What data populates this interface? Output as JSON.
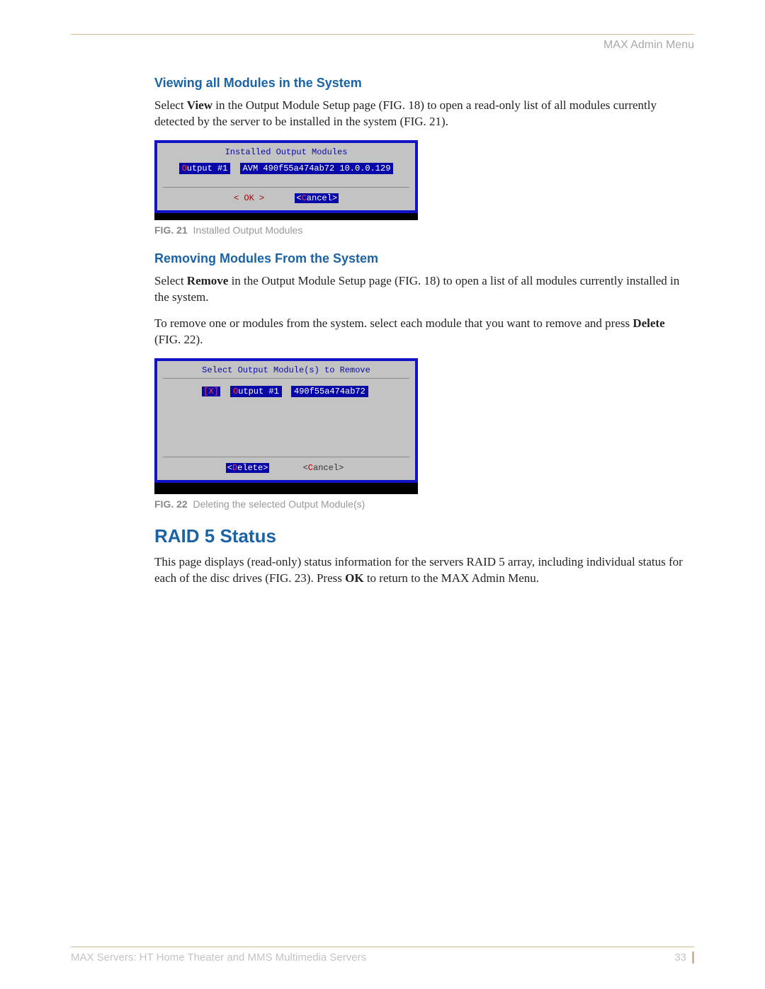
{
  "header": {
    "section": "MAX Admin Menu"
  },
  "sections": {
    "view": {
      "heading": "Viewing all Modules in the System",
      "p1a": "Select ",
      "p1b": "View",
      "p1c": " in the Output Module Setup page (FIG. 18) to open a read-only list of all modules currently detected by the server to be installed in the system (FIG. 21)."
    },
    "remove": {
      "heading": "Removing Modules From the System",
      "p1a": "Select ",
      "p1b": "Remove",
      "p1c": " in the Output Module Setup page (FIG. 18) to open a list of all modules currently installed in the system.",
      "p2a": "To remove one or modules from the system. select each module that you want to remove and press ",
      "p2b": "Delete",
      "p2c": " (FIG. 22)."
    },
    "raid": {
      "heading": "RAID 5 Status",
      "p1a": "This page displays (read-only) status information for the servers RAID 5 array, including individual status for each of the disc drives (FIG. 23). Press ",
      "p1b": "OK",
      "p1c": " to return to the MAX Admin Menu."
    }
  },
  "fig21": {
    "title": "Installed Output Modules",
    "output_label": "Output #1",
    "module_text": "AVM 490f55a474ab72 10.0.0.129",
    "ok": "<  OK  >",
    "cancel_full": "<Cancel>",
    "caption_label": "FIG. 21",
    "caption_text": "Installed Output Modules"
  },
  "fig22": {
    "title": "Select Output Module(s) to Remove",
    "checkbox": "[X]",
    "output_label": "Output #1",
    "module_id": "490f55a474ab72",
    "delete_full": "<Delete>",
    "cancel_full": "<Cancel>",
    "caption_label": "FIG. 22",
    "caption_text": "Deleting the selected Output Module(s)"
  },
  "footer": {
    "left": "MAX Servers: HT Home Theater and MMS Multimedia Servers",
    "page": "33"
  }
}
